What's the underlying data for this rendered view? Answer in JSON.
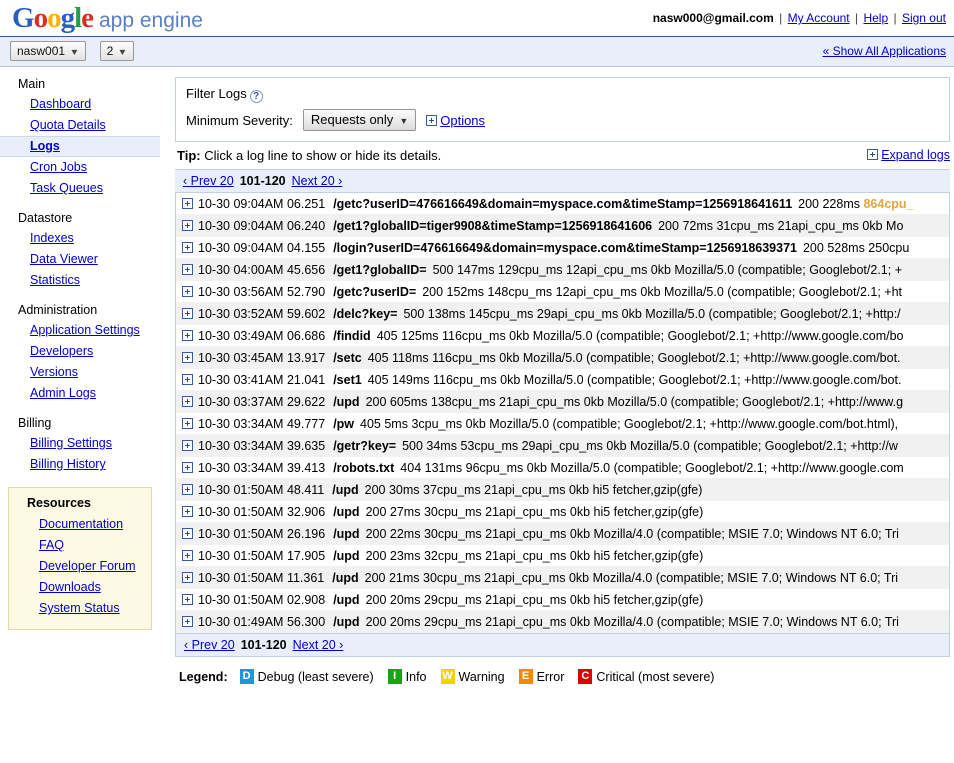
{
  "header": {
    "logo": {
      "google": "Google",
      "product": "app engine"
    },
    "email": "nasw000@gmail.com",
    "my_account": "My Account",
    "help": "Help",
    "sign_out": "Sign out",
    "separator": "|"
  },
  "appbar": {
    "app_select": "nasw001",
    "version_select": "2",
    "show_all_applications": "« Show All Applications"
  },
  "sidebar": {
    "groups": [
      {
        "title": "Main",
        "items": [
          {
            "label": "Dashboard",
            "active": false
          },
          {
            "label": "Quota Details",
            "active": false
          },
          {
            "label": "Logs",
            "active": true
          },
          {
            "label": "Cron Jobs",
            "active": false
          },
          {
            "label": "Task Queues",
            "active": false
          }
        ]
      },
      {
        "title": "Datastore",
        "items": [
          {
            "label": "Indexes",
            "active": false
          },
          {
            "label": "Data Viewer",
            "active": false
          },
          {
            "label": "Statistics",
            "active": false
          }
        ]
      },
      {
        "title": "Administration",
        "items": [
          {
            "label": "Application Settings",
            "active": false
          },
          {
            "label": "Developers",
            "active": false
          },
          {
            "label": "Versions",
            "active": false
          },
          {
            "label": "Admin Logs",
            "active": false
          }
        ]
      },
      {
        "title": "Billing",
        "items": [
          {
            "label": "Billing Settings",
            "active": false
          },
          {
            "label": "Billing History",
            "active": false
          }
        ]
      }
    ],
    "resources": {
      "title": "Resources",
      "items": [
        {
          "label": "Documentation"
        },
        {
          "label": "FAQ"
        },
        {
          "label": "Developer Forum"
        },
        {
          "label": "Downloads"
        },
        {
          "label": "System Status"
        }
      ]
    }
  },
  "filter": {
    "title": "Filter Logs",
    "help_icon": "question-mark-icon",
    "severity_label": "Minimum Severity:",
    "severity_value": "Requests only",
    "options_label": "Options"
  },
  "tip": {
    "prefix": "Tip:",
    "text": " Click a log line to show or hide its details.",
    "expand_logs": "Expand logs"
  },
  "pager": {
    "prev": "‹ Prev 20",
    "range": "101-120",
    "next": "Next 20 ›"
  },
  "logs": [
    {
      "timestamp": "10-30 09:04AM 06.251",
      "path": "/getc?userID=476616649&domain=myspace.com&timeStamp=1256918641611",
      "rest": "200  228ms  ",
      "hot": "864cpu_",
      "alt": false
    },
    {
      "timestamp": "10-30 09:04AM 06.240",
      "path": "/get1?globalID=tiger9908&timeStamp=1256918641606",
      "rest": "200  72ms  31cpu_ms 21api_cpu_ms  0kb  Mo",
      "hot": "",
      "alt": true
    },
    {
      "timestamp": "10-30 09:04AM 04.155",
      "path": "/login?userID=476616649&domain=myspace.com&timeStamp=1256918639371",
      "rest": "200  528ms  250cpu",
      "hot": "",
      "alt": false
    },
    {
      "timestamp": "10-30 04:00AM 45.656",
      "path": "/get1?globalID=",
      "rest": "500  147ms  129cpu_ms 12api_cpu_ms  0kb  Mozilla/5.0 (compatible; Googlebot/2.1; +",
      "hot": "",
      "alt": true
    },
    {
      "timestamp": "10-30 03:56AM 52.790",
      "path": "/getc?userID=",
      "rest": "200  152ms  148cpu_ms 12api_cpu_ms  0kb  Mozilla/5.0 (compatible; Googlebot/2.1; +ht",
      "hot": "",
      "alt": false
    },
    {
      "timestamp": "10-30 03:52AM 59.602",
      "path": "/delc?key=",
      "rest": "500  138ms  145cpu_ms 29api_cpu_ms  0kb  Mozilla/5.0 (compatible; Googlebot/2.1; +http:/",
      "hot": "",
      "alt": true
    },
    {
      "timestamp": "10-30 03:49AM 06.686",
      "path": "/findid",
      "rest": "405  125ms  116cpu_ms  0kb  Mozilla/5.0 (compatible; Googlebot/2.1; +http://www.google.com/bo",
      "hot": "",
      "alt": false
    },
    {
      "timestamp": "10-30 03:45AM 13.917",
      "path": "/setc",
      "rest": "405  118ms  116cpu_ms  0kb  Mozilla/5.0 (compatible; Googlebot/2.1; +http://www.google.com/bot.",
      "hot": "",
      "alt": true
    },
    {
      "timestamp": "10-30 03:41AM 21.041",
      "path": "/set1",
      "rest": "405  149ms  116cpu_ms  0kb  Mozilla/5.0 (compatible; Googlebot/2.1; +http://www.google.com/bot.",
      "hot": "",
      "alt": false
    },
    {
      "timestamp": "10-30 03:37AM 29.622",
      "path": "/upd",
      "rest": "200  605ms  138cpu_ms 21api_cpu_ms  0kb  Mozilla/5.0 (compatible; Googlebot/2.1; +http://www.g",
      "hot": "",
      "alt": true
    },
    {
      "timestamp": "10-30 03:34AM 49.777",
      "path": "/pw",
      "rest": "405  5ms  3cpu_ms  0kb  Mozilla/5.0 (compatible; Googlebot/2.1; +http://www.google.com/bot.html),",
      "hot": "",
      "alt": false
    },
    {
      "timestamp": "10-30 03:34AM 39.635",
      "path": "/getr?key=",
      "rest": "500  34ms  53cpu_ms 29api_cpu_ms  0kb  Mozilla/5.0 (compatible; Googlebot/2.1; +http://w",
      "hot": "",
      "alt": true
    },
    {
      "timestamp": "10-30 03:34AM 39.413",
      "path": "/robots.txt",
      "rest": "404  131ms  96cpu_ms  0kb  Mozilla/5.0 (compatible; Googlebot/2.1; +http://www.google.com",
      "hot": "",
      "alt": false
    },
    {
      "timestamp": "10-30 01:50AM 48.411",
      "path": "/upd",
      "rest": "200  30ms  37cpu_ms 21api_cpu_ms  0kb  hi5 fetcher,gzip(gfe)",
      "hot": "",
      "alt": true
    },
    {
      "timestamp": "10-30 01:50AM 32.906",
      "path": "/upd",
      "rest": "200  27ms  30cpu_ms 21api_cpu_ms  0kb  hi5 fetcher,gzip(gfe)",
      "hot": "",
      "alt": false
    },
    {
      "timestamp": "10-30 01:50AM 26.196",
      "path": "/upd",
      "rest": "200  22ms  30cpu_ms 21api_cpu_ms  0kb  Mozilla/4.0 (compatible; MSIE 7.0; Windows NT 6.0; Tri",
      "hot": "",
      "alt": true
    },
    {
      "timestamp": "10-30 01:50AM 17.905",
      "path": "/upd",
      "rest": "200  23ms  32cpu_ms 21api_cpu_ms  0kb  hi5 fetcher,gzip(gfe)",
      "hot": "",
      "alt": false
    },
    {
      "timestamp": "10-30 01:50AM 11.361",
      "path": "/upd",
      "rest": "200  21ms  30cpu_ms 21api_cpu_ms  0kb  Mozilla/4.0 (compatible; MSIE 7.0; Windows NT 6.0; Tri",
      "hot": "",
      "alt": true
    },
    {
      "timestamp": "10-30 01:50AM 02.908",
      "path": "/upd",
      "rest": "200  20ms  29cpu_ms 21api_cpu_ms  0kb  hi5 fetcher,gzip(gfe)",
      "hot": "",
      "alt": false
    },
    {
      "timestamp": "10-30 01:49AM 56.300",
      "path": "/upd",
      "rest": "200  20ms  29cpu_ms 21api_cpu_ms  0kb  Mozilla/4.0 (compatible; MSIE 7.0; Windows NT 6.0; Tri",
      "hot": "",
      "alt": true
    }
  ],
  "legend": {
    "title": "Legend:",
    "items": [
      {
        "letter": "D",
        "label": "Debug (least severe)",
        "color": "#2196d6"
      },
      {
        "letter": "I",
        "label": "Info",
        "color": "#19a319"
      },
      {
        "letter": "W",
        "label": "Warning",
        "color": "#f2d200"
      },
      {
        "letter": "E",
        "label": "Error",
        "color": "#f08a00"
      },
      {
        "letter": "C",
        "label": "Critical (most severe)",
        "color": "#e00000"
      }
    ]
  }
}
